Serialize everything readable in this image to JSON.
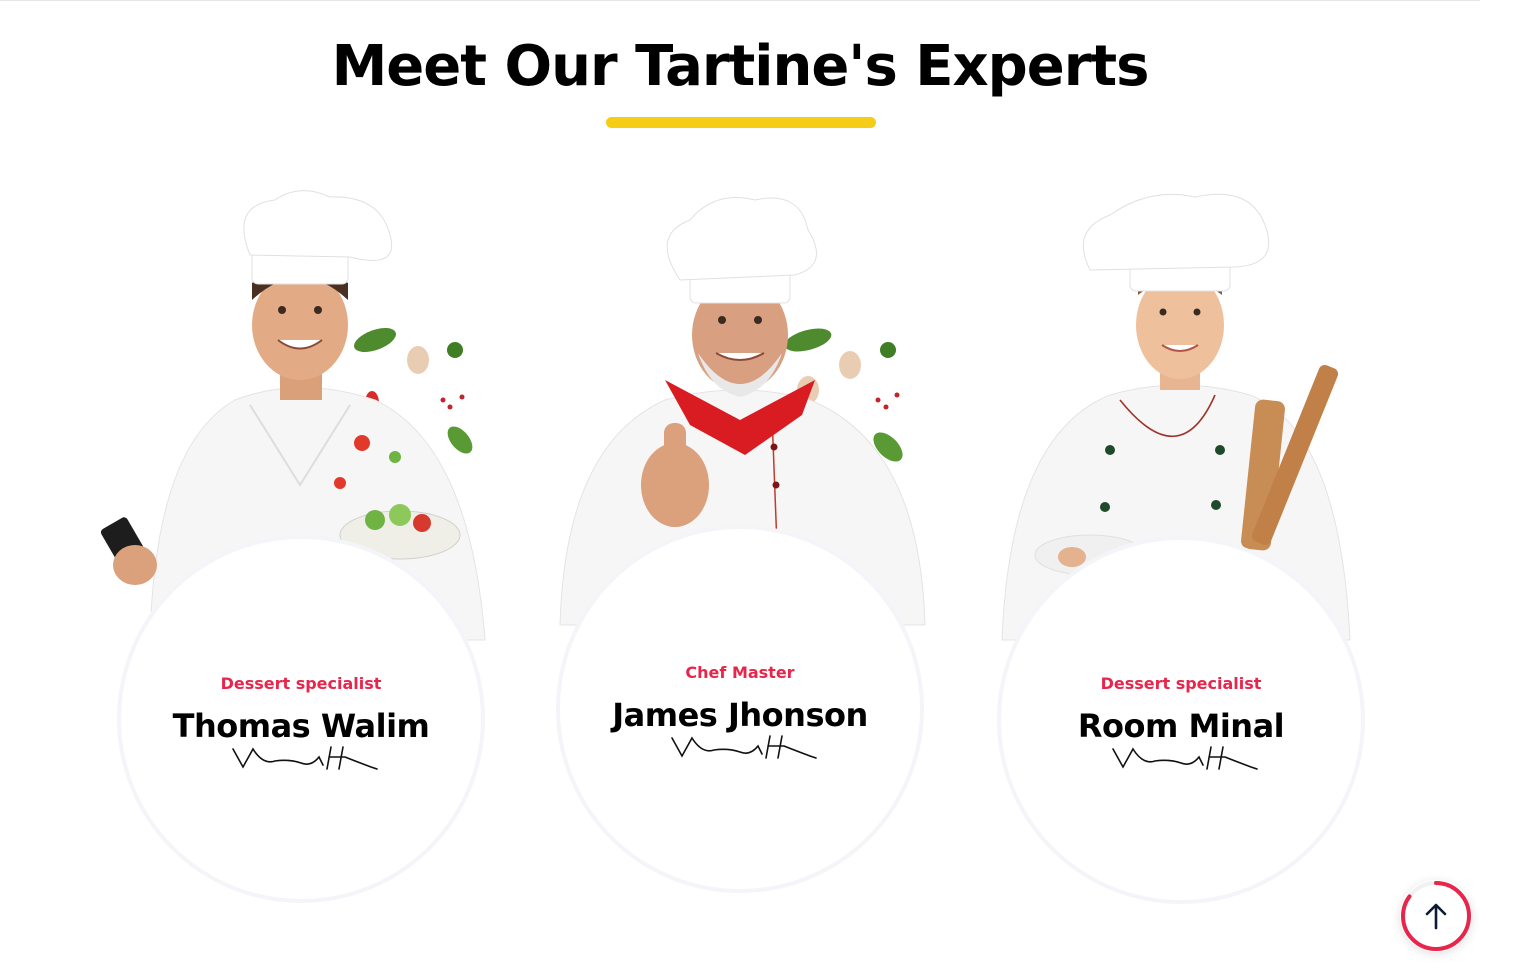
{
  "section": {
    "title": "Meet Our Tartine's Experts",
    "accent_color": "#f5cc16"
  },
  "chefs": [
    {
      "role": "Dessert specialist",
      "name": "Thomas Walim",
      "role_color": "#e8254b"
    },
    {
      "role": "Chef Master",
      "name": "James Jhonson",
      "role_color": "#e8254b"
    },
    {
      "role": "Dessert specialist",
      "name": "Room Minal",
      "role_color": "#e8254b"
    }
  ],
  "scroll_top": {
    "icon": "arrow-up-icon",
    "ring_color": "#e8254b",
    "progress": 0.85
  }
}
